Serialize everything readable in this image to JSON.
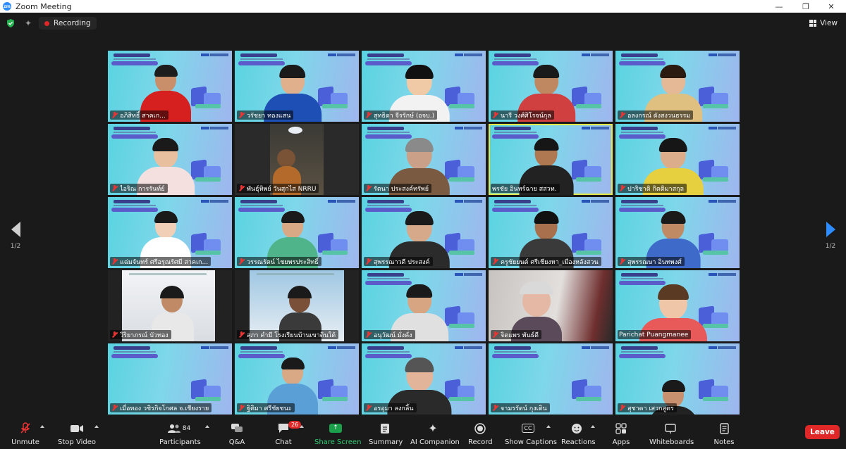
{
  "window": {
    "title": "Zoom Meeting",
    "logo_text": "zm"
  },
  "topbar": {
    "recording_label": "Recording",
    "view_label": "View"
  },
  "nav": {
    "page_left": "1/2",
    "page_right": "1/2"
  },
  "participants": [
    {
      "name": "อภิสิทธิ์ สาคเก..."
    },
    {
      "name": "วรัชยา ทองแสน"
    },
    {
      "name": "สุทธิดา จีรรักษ์ (อจบ.)"
    },
    {
      "name": "นารี วงศ์ศิโรจน์กุล"
    },
    {
      "name": "อลงกรณ์ ดังสงวนธรรม"
    },
    {
      "name": "ไอริณ การรันท์ย์"
    },
    {
      "name": "พันธุ์ทิพย์ วันสุกไส NRRU"
    },
    {
      "name": "รัตนา ประสงค์ทรัพย์"
    },
    {
      "name": "พรชัย อินทร์ฉาย สสวท."
    },
    {
      "name": "ปาริชาติ กิตติมาสกุล"
    },
    {
      "name": "แฉ่มจันทร์ ศรีอรุณรัศมี สาคเก..."
    },
    {
      "name": "วรรณรัตน์ ไชยพรประสิทธิ์"
    },
    {
      "name": "สุพรรณาวดี ประสงค์"
    },
    {
      "name": "ครูชัยยนต์ ศรีเชียงหา_เมืองหลังสวน"
    },
    {
      "name": "สุพรรณษา อินทพงศ์"
    },
    {
      "name": "วิริยาภรณ์ บัวทอง"
    },
    {
      "name": "สุภา คำมี โรงเรียนบ้านเขาดินใต้"
    },
    {
      "name": "อนุวัฒน์ มั่งคั่ง"
    },
    {
      "name": "จิตแพร พันธ์ดี"
    },
    {
      "name": "Parichat Puangmanee"
    },
    {
      "name": "เมื่อทอง วชิรกิจโกศล จ.เชียงราย"
    },
    {
      "name": "ฐิติมา ศรีชัยชนะ"
    },
    {
      "name": "อรอุมา ลงกลิ้น"
    },
    {
      "name": "จามรรัตน์ กุงเติน"
    },
    {
      "name": "สุชาดา เสวกสูตร"
    }
  ],
  "toolbar": {
    "unmute": "Unmute",
    "stop_video": "Stop Video",
    "participants": "Participants",
    "participants_count": "84",
    "qa": "Q&A",
    "chat": "Chat",
    "chat_badge": "26",
    "share_screen": "Share Screen",
    "summary": "Summary",
    "ai_companion": "AI Companion",
    "record": "Record",
    "show_captions": "Show Captions",
    "cc_icon": "CC",
    "reactions": "Reactions",
    "apps": "Apps",
    "whiteboards": "Whiteboards",
    "notes": "Notes",
    "leave": "Leave"
  },
  "colors": {
    "accent": "#2d8cff",
    "leave": "#e02828",
    "share": "#1aa04a",
    "active_speaker": "#e4e94a"
  }
}
